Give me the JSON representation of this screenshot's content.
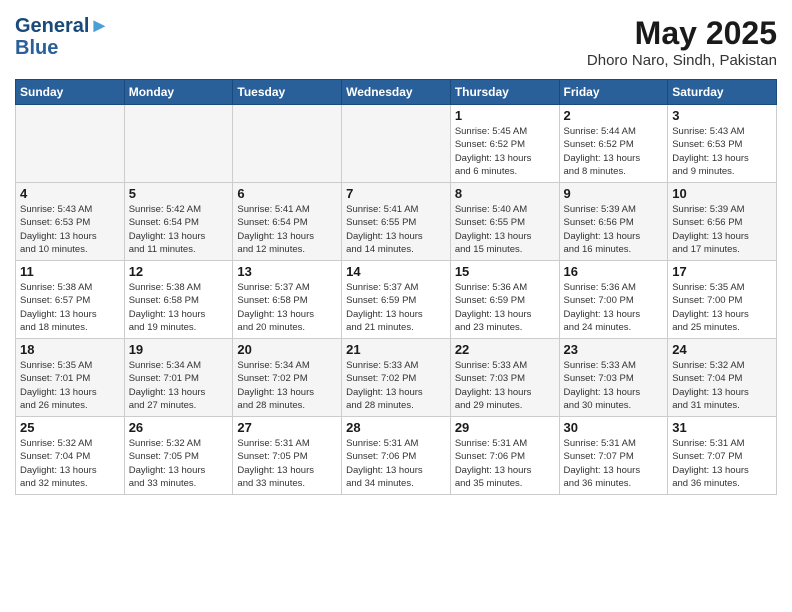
{
  "header": {
    "logo_line1": "General",
    "logo_line2": "Blue",
    "month_year": "May 2025",
    "location": "Dhoro Naro, Sindh, Pakistan"
  },
  "days_of_week": [
    "Sunday",
    "Monday",
    "Tuesday",
    "Wednesday",
    "Thursday",
    "Friday",
    "Saturday"
  ],
  "weeks": [
    [
      {
        "num": "",
        "info": "",
        "empty": true
      },
      {
        "num": "",
        "info": "",
        "empty": true
      },
      {
        "num": "",
        "info": "",
        "empty": true
      },
      {
        "num": "",
        "info": "",
        "empty": true
      },
      {
        "num": "1",
        "info": "Sunrise: 5:45 AM\nSunset: 6:52 PM\nDaylight: 13 hours\nand 6 minutes.",
        "empty": false
      },
      {
        "num": "2",
        "info": "Sunrise: 5:44 AM\nSunset: 6:52 PM\nDaylight: 13 hours\nand 8 minutes.",
        "empty": false
      },
      {
        "num": "3",
        "info": "Sunrise: 5:43 AM\nSunset: 6:53 PM\nDaylight: 13 hours\nand 9 minutes.",
        "empty": false
      }
    ],
    [
      {
        "num": "4",
        "info": "Sunrise: 5:43 AM\nSunset: 6:53 PM\nDaylight: 13 hours\nand 10 minutes.",
        "empty": false
      },
      {
        "num": "5",
        "info": "Sunrise: 5:42 AM\nSunset: 6:54 PM\nDaylight: 13 hours\nand 11 minutes.",
        "empty": false
      },
      {
        "num": "6",
        "info": "Sunrise: 5:41 AM\nSunset: 6:54 PM\nDaylight: 13 hours\nand 12 minutes.",
        "empty": false
      },
      {
        "num": "7",
        "info": "Sunrise: 5:41 AM\nSunset: 6:55 PM\nDaylight: 13 hours\nand 14 minutes.",
        "empty": false
      },
      {
        "num": "8",
        "info": "Sunrise: 5:40 AM\nSunset: 6:55 PM\nDaylight: 13 hours\nand 15 minutes.",
        "empty": false
      },
      {
        "num": "9",
        "info": "Sunrise: 5:39 AM\nSunset: 6:56 PM\nDaylight: 13 hours\nand 16 minutes.",
        "empty": false
      },
      {
        "num": "10",
        "info": "Sunrise: 5:39 AM\nSunset: 6:56 PM\nDaylight: 13 hours\nand 17 minutes.",
        "empty": false
      }
    ],
    [
      {
        "num": "11",
        "info": "Sunrise: 5:38 AM\nSunset: 6:57 PM\nDaylight: 13 hours\nand 18 minutes.",
        "empty": false
      },
      {
        "num": "12",
        "info": "Sunrise: 5:38 AM\nSunset: 6:58 PM\nDaylight: 13 hours\nand 19 minutes.",
        "empty": false
      },
      {
        "num": "13",
        "info": "Sunrise: 5:37 AM\nSunset: 6:58 PM\nDaylight: 13 hours\nand 20 minutes.",
        "empty": false
      },
      {
        "num": "14",
        "info": "Sunrise: 5:37 AM\nSunset: 6:59 PM\nDaylight: 13 hours\nand 21 minutes.",
        "empty": false
      },
      {
        "num": "15",
        "info": "Sunrise: 5:36 AM\nSunset: 6:59 PM\nDaylight: 13 hours\nand 23 minutes.",
        "empty": false
      },
      {
        "num": "16",
        "info": "Sunrise: 5:36 AM\nSunset: 7:00 PM\nDaylight: 13 hours\nand 24 minutes.",
        "empty": false
      },
      {
        "num": "17",
        "info": "Sunrise: 5:35 AM\nSunset: 7:00 PM\nDaylight: 13 hours\nand 25 minutes.",
        "empty": false
      }
    ],
    [
      {
        "num": "18",
        "info": "Sunrise: 5:35 AM\nSunset: 7:01 PM\nDaylight: 13 hours\nand 26 minutes.",
        "empty": false
      },
      {
        "num": "19",
        "info": "Sunrise: 5:34 AM\nSunset: 7:01 PM\nDaylight: 13 hours\nand 27 minutes.",
        "empty": false
      },
      {
        "num": "20",
        "info": "Sunrise: 5:34 AM\nSunset: 7:02 PM\nDaylight: 13 hours\nand 28 minutes.",
        "empty": false
      },
      {
        "num": "21",
        "info": "Sunrise: 5:33 AM\nSunset: 7:02 PM\nDaylight: 13 hours\nand 28 minutes.",
        "empty": false
      },
      {
        "num": "22",
        "info": "Sunrise: 5:33 AM\nSunset: 7:03 PM\nDaylight: 13 hours\nand 29 minutes.",
        "empty": false
      },
      {
        "num": "23",
        "info": "Sunrise: 5:33 AM\nSunset: 7:03 PM\nDaylight: 13 hours\nand 30 minutes.",
        "empty": false
      },
      {
        "num": "24",
        "info": "Sunrise: 5:32 AM\nSunset: 7:04 PM\nDaylight: 13 hours\nand 31 minutes.",
        "empty": false
      }
    ],
    [
      {
        "num": "25",
        "info": "Sunrise: 5:32 AM\nSunset: 7:04 PM\nDaylight: 13 hours\nand 32 minutes.",
        "empty": false
      },
      {
        "num": "26",
        "info": "Sunrise: 5:32 AM\nSunset: 7:05 PM\nDaylight: 13 hours\nand 33 minutes.",
        "empty": false
      },
      {
        "num": "27",
        "info": "Sunrise: 5:31 AM\nSunset: 7:05 PM\nDaylight: 13 hours\nand 33 minutes.",
        "empty": false
      },
      {
        "num": "28",
        "info": "Sunrise: 5:31 AM\nSunset: 7:06 PM\nDaylight: 13 hours\nand 34 minutes.",
        "empty": false
      },
      {
        "num": "29",
        "info": "Sunrise: 5:31 AM\nSunset: 7:06 PM\nDaylight: 13 hours\nand 35 minutes.",
        "empty": false
      },
      {
        "num": "30",
        "info": "Sunrise: 5:31 AM\nSunset: 7:07 PM\nDaylight: 13 hours\nand 36 minutes.",
        "empty": false
      },
      {
        "num": "31",
        "info": "Sunrise: 5:31 AM\nSunset: 7:07 PM\nDaylight: 13 hours\nand 36 minutes.",
        "empty": false
      }
    ]
  ]
}
